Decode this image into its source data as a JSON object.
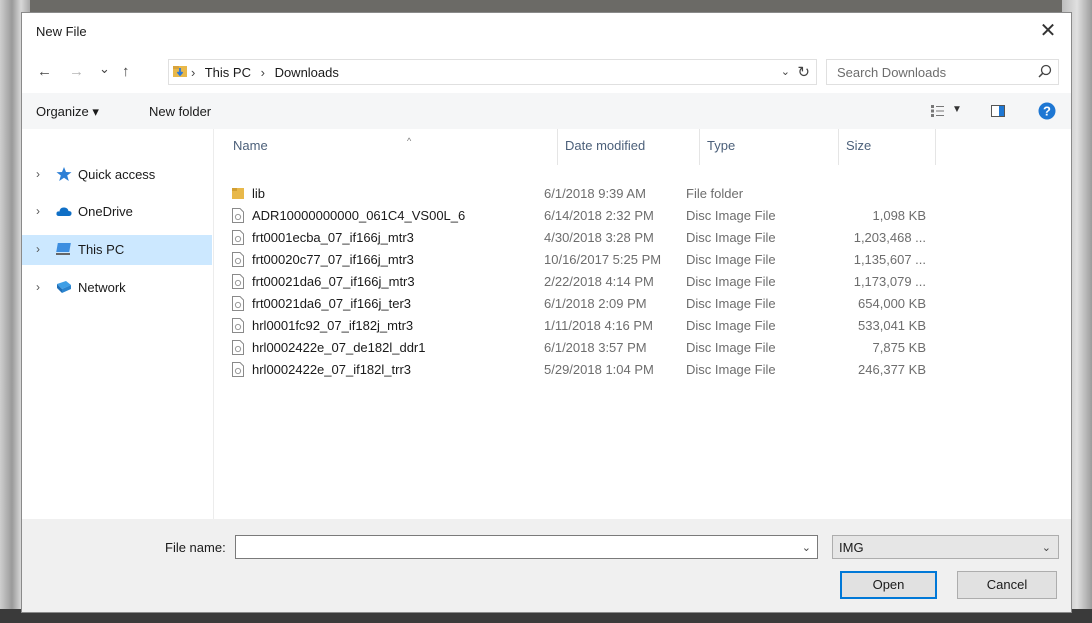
{
  "dialog": {
    "title": "New File"
  },
  "nav": {
    "back": "←",
    "forward": "→",
    "recent": "⌄",
    "up": "↑",
    "breadcrumb": [
      "This PC",
      "Downloads"
    ],
    "search_placeholder": "Search Downloads"
  },
  "toolbar": {
    "organize": "Organize ▾",
    "new_folder": "New folder"
  },
  "sidebar": {
    "items": [
      {
        "label": "Quick access",
        "icon": "star-icon",
        "color": "#2c7fd6"
      },
      {
        "label": "OneDrive",
        "icon": "cloud-icon",
        "color": "#0f6fc6"
      },
      {
        "label": "This PC",
        "icon": "pc-icon",
        "selected": true
      },
      {
        "label": "Network",
        "icon": "network-icon"
      }
    ]
  },
  "columns": {
    "name": "Name",
    "date": "Date modified",
    "type": "Type",
    "size": "Size"
  },
  "files": [
    {
      "name": "lib",
      "date": "6/1/2018 9:39 AM",
      "type": "File folder",
      "size": "",
      "icon": "folder-icon"
    },
    {
      "name": "ADR10000000000_061C4_VS00L_6",
      "date": "6/14/2018 2:32 PM",
      "type": "Disc Image File",
      "size": "1,098 KB",
      "icon": "file-icon"
    },
    {
      "name": "frt0001ecba_07_if166j_mtr3",
      "date": "4/30/2018 3:28 PM",
      "type": "Disc Image File",
      "size": "1,203,468 ...",
      "icon": "file-icon"
    },
    {
      "name": "frt00020c77_07_if166j_mtr3",
      "date": "10/16/2017 5:25 PM",
      "type": "Disc Image File",
      "size": "1,135,607 ...",
      "icon": "file-icon"
    },
    {
      "name": "frt00021da6_07_if166j_mtr3",
      "date": "2/22/2018 4:14 PM",
      "type": "Disc Image File",
      "size": "1,173,079 ...",
      "icon": "file-icon"
    },
    {
      "name": "frt00021da6_07_if166j_ter3",
      "date": "6/1/2018 2:09 PM",
      "type": "Disc Image File",
      "size": "654,000 KB",
      "icon": "file-icon"
    },
    {
      "name": "hrl0001fc92_07_if182j_mtr3",
      "date": "1/11/2018 4:16 PM",
      "type": "Disc Image File",
      "size": "533,041 KB",
      "icon": "file-icon"
    },
    {
      "name": "hrl0002422e_07_de182l_ddr1",
      "date": "6/1/2018 3:57 PM",
      "type": "Disc Image File",
      "size": "7,875 KB",
      "icon": "file-icon"
    },
    {
      "name": "hrl0002422e_07_if182l_trr3",
      "date": "5/29/2018 1:04 PM",
      "type": "Disc Image File",
      "size": "246,377 KB",
      "icon": "file-icon"
    }
  ],
  "footer": {
    "file_name_label": "File name:",
    "file_name_value": "",
    "file_type": "IMG",
    "open": "Open",
    "cancel": "Cancel"
  },
  "colors": {
    "accent": "#0078d7",
    "selection": "#cce8ff",
    "help": "#1e77d3"
  }
}
